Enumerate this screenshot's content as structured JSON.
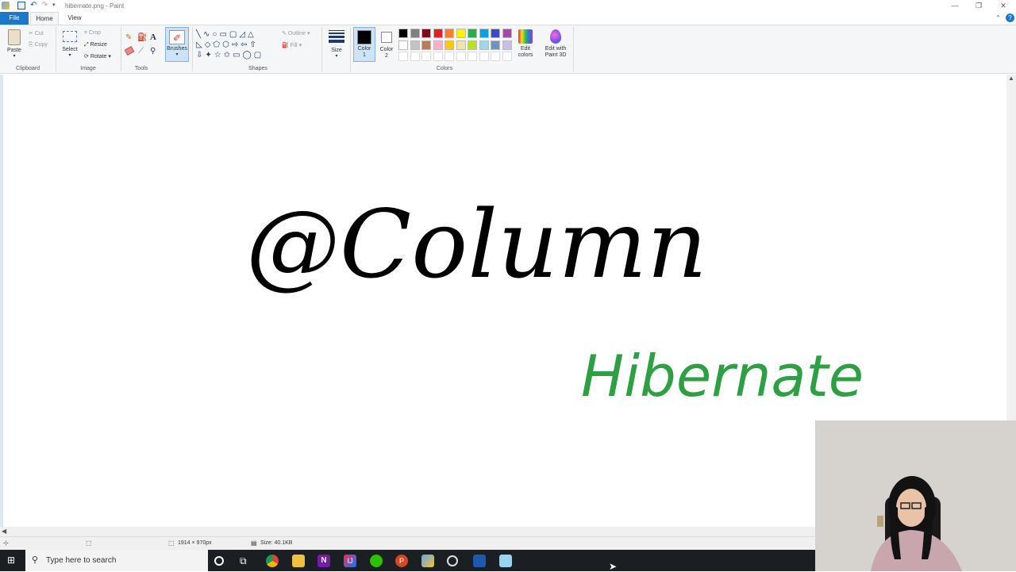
{
  "window": {
    "title": "hibernate.png - Paint"
  },
  "tabs": {
    "file": "File",
    "home": "Home",
    "view": "View"
  },
  "clipboard": {
    "paste": "Paste",
    "cut": "Cut",
    "copy": "Copy",
    "group": "Clipboard"
  },
  "image": {
    "select": "Select",
    "crop": "Crop",
    "resize": "Resize",
    "rotate": "Rotate",
    "group": "Image"
  },
  "tools": {
    "group": "Tools",
    "brushes": "Brushes"
  },
  "shapes": {
    "outline": "Outline",
    "fill": "Fill",
    "group": "Shapes"
  },
  "size": {
    "label": "Size"
  },
  "colors": {
    "color1_label": "Color\n1",
    "color2_label": "Color\n2",
    "edit_colors": "Edit\ncolors",
    "edit_paint3d": "Edit with\nPaint 3D",
    "group": "Colors",
    "color1": "#000000",
    "color2": "#ffffff",
    "palette_row1": [
      "#000000",
      "#7f7f7f",
      "#880015",
      "#ed1c24",
      "#ff7f27",
      "#fff200",
      "#22b14c",
      "#00a2e8",
      "#3f48cc",
      "#a349a4"
    ],
    "palette_row2": [
      "#ffffff",
      "#c3c3c3",
      "#b97a57",
      "#ffaec9",
      "#ffc90e",
      "#efe4b0",
      "#b5e61d",
      "#99d9ea",
      "#7092be",
      "#c8bfe7"
    ]
  },
  "canvas": {
    "text_main": "@Column",
    "text_secondary": "Hibernate",
    "main_color": "#000000",
    "secondary_color": "#2ea043"
  },
  "status": {
    "dimensions": "1914 × 970px",
    "size": "Size: 40.1KB"
  },
  "taskbar": {
    "search_placeholder": "Type here to search"
  }
}
